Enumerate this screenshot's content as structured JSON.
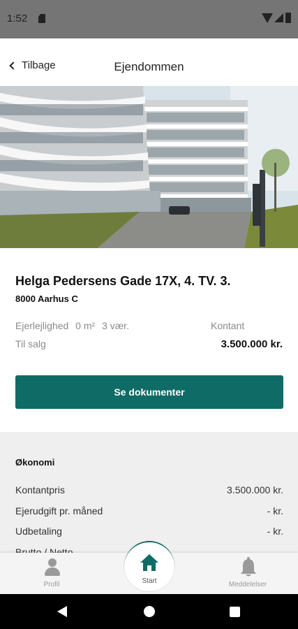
{
  "status_bar": {
    "time": "1:52"
  },
  "header": {
    "back_label": "Tilbage",
    "title": "Ejendommen"
  },
  "property": {
    "address": "Helga Pedersens Gade 17X, 4. TV. 3.",
    "city": "8000 Aarhus C",
    "type": "Ejerlejlighed",
    "area": "0 m²",
    "rooms": "3 vær.",
    "status": "Til salg",
    "price_label": "Kontant",
    "price_value": "3.500.000 kr."
  },
  "cta": {
    "label": "Se dokumenter",
    "color": "#0f6b66"
  },
  "economy": {
    "title": "Økonomi",
    "rows": [
      {
        "label": "Kontantpris",
        "value": "3.500.000 kr."
      },
      {
        "label": "Ejerudgift pr. måned",
        "value": "- kr."
      },
      {
        "label": "Udbetaling",
        "value": "- kr."
      },
      {
        "label": "Brutto / Netto",
        "value": ""
      }
    ]
  },
  "bottom_nav": {
    "profile_label": "Profil",
    "home_label": "Start",
    "notifications_label": "Meddelelser",
    "accent": "#0f6b66"
  },
  "icons": {
    "back": "chevron-left-icon",
    "profile": "person-icon",
    "home": "home-icon",
    "notifications": "bell-icon"
  }
}
